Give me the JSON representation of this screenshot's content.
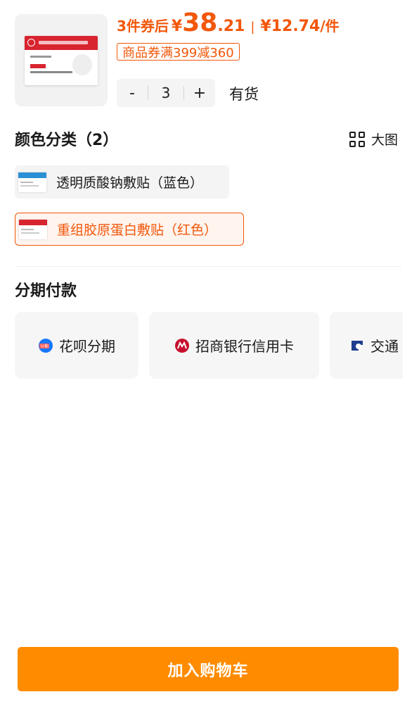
{
  "product": {
    "image_icon": "facial-mask-package",
    "price": {
      "prefix": "3件券后",
      "currency": "¥",
      "integer": "38",
      "decimal": ".21",
      "separator": "|",
      "unit_price": "¥12.74",
      "unit_suffix": "/件"
    },
    "coupon": "商品券满399减360",
    "quantity": {
      "minus": "-",
      "value": "3",
      "plus": "+"
    },
    "stock_status": "有货"
  },
  "color_section": {
    "title": "颜色分类（2）",
    "big_view_label": "大图",
    "big_view_icon": "grid-icon",
    "options": [
      {
        "label": "透明质酸钠敷贴（蓝色）",
        "selected": false,
        "accent": "#2b8fd6"
      },
      {
        "label": "重组胶原蛋白敷贴（红色）",
        "selected": true,
        "accent": "#d8242f"
      }
    ]
  },
  "installment_section": {
    "title": "分期付款",
    "options": [
      {
        "label": "花呗分期",
        "icon": "huabei-icon"
      },
      {
        "label": "招商银行信用卡",
        "icon": "cmb-bank-icon"
      },
      {
        "label": "交通",
        "icon": "bocom-bank-icon"
      }
    ]
  },
  "actions": {
    "add_to_cart": "加入购物车"
  },
  "colors": {
    "accent": "#f2570a",
    "button": "#ff8c00"
  }
}
